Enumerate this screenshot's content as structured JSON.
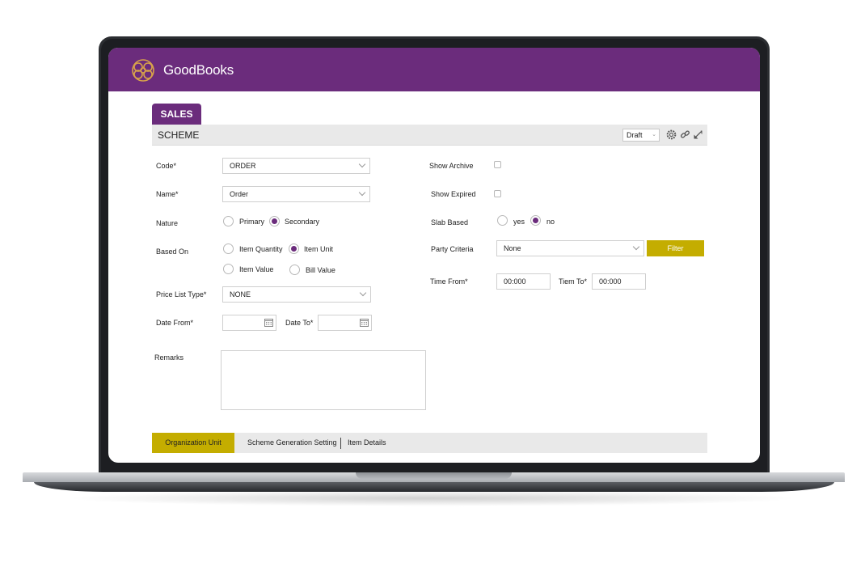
{
  "app": {
    "brand": "GoodBooks",
    "module": "SALES",
    "page_title": "SCHEME",
    "status": "Draft"
  },
  "colors": {
    "brand": "#6b2c7c",
    "accent": "#c4ad00"
  },
  "form": {
    "code": {
      "label": "Code*",
      "value": "ORDER"
    },
    "name": {
      "label": "Name*",
      "value": "Order"
    },
    "nature": {
      "label": "Nature",
      "options": [
        "Primary",
        "Secondary"
      ],
      "selected": "Secondary"
    },
    "based_on": {
      "label": "Based On",
      "options": [
        "Item Quantity",
        "Item Unit",
        "Item Value",
        "Bill Value"
      ],
      "selected": "Item Unit"
    },
    "price_list_type": {
      "label": "Price List Type*",
      "value": "NONE"
    },
    "date_from": {
      "label": "Date From*",
      "value": ""
    },
    "date_to": {
      "label": "Date To*",
      "value": ""
    },
    "remarks": {
      "label": "Remarks",
      "value": ""
    },
    "show_archive": {
      "label": "Show Archive",
      "checked": false
    },
    "show_expired": {
      "label": "Show Expired",
      "checked": false
    },
    "slab_based": {
      "label": "Slab Based",
      "options": [
        "yes",
        "no"
      ],
      "selected": "no"
    },
    "party_criteria": {
      "label": "Party Criteria",
      "value": "None"
    },
    "filter_button": "Filter",
    "time_from": {
      "label": "Time From*",
      "value": "00:000"
    },
    "time_to": {
      "label": "Tiem To*",
      "value": "00:000"
    }
  },
  "bottom_tabs": [
    "Organization Unit",
    "Scheme Generation Setting",
    "Item Details"
  ],
  "icons": [
    "gear-icon",
    "link-icon",
    "expand-icon",
    "calendar-icon",
    "chevron-down-icon"
  ]
}
